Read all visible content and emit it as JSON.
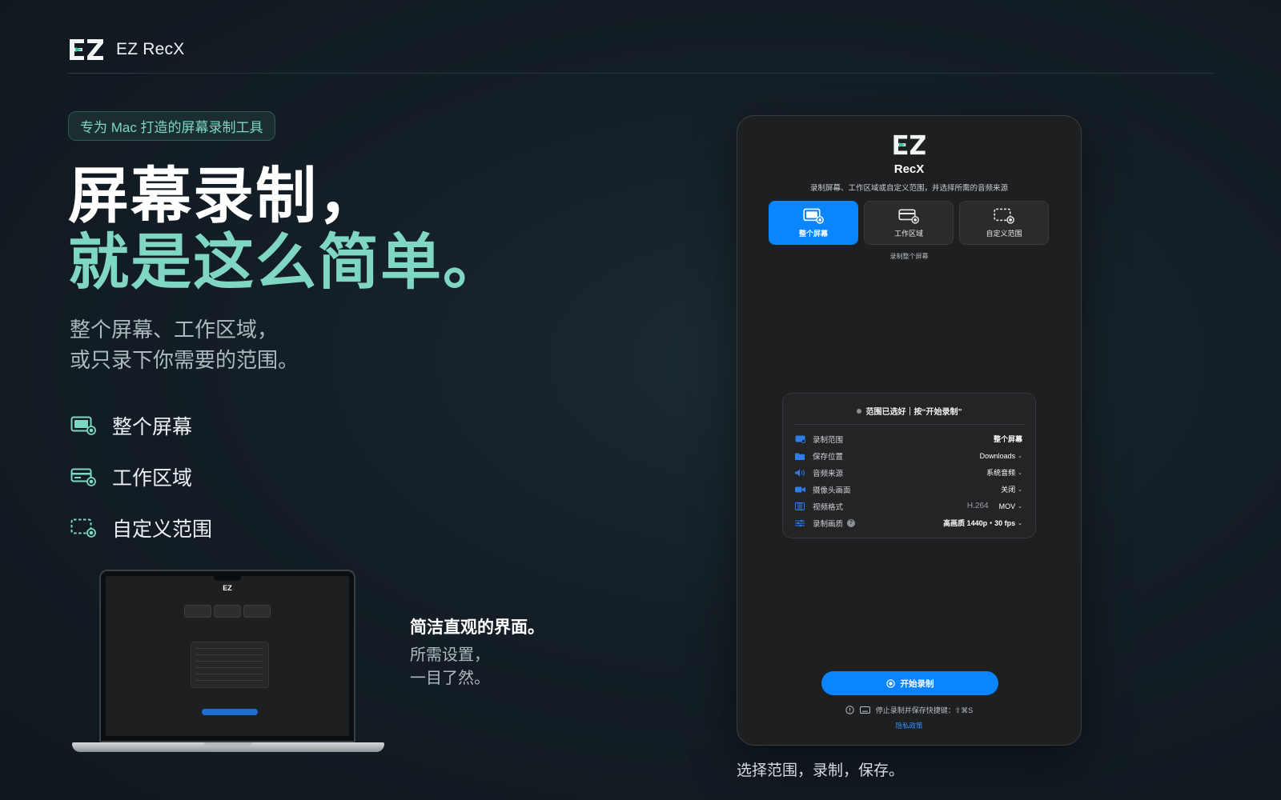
{
  "header": {
    "brand": "EZ RecX"
  },
  "hero": {
    "badge": "专为 Mac 打造的屏幕录制工具",
    "title_line1": "屏幕录制，",
    "title_line2": "就是这么简单。",
    "sub_line1": "整个屏幕、工作区域，",
    "sub_line2": "或只录下你需要的范围。"
  },
  "features": [
    {
      "label": "整个屏幕",
      "icon": "full-screen-icon"
    },
    {
      "label": "工作区域",
      "icon": "work-area-icon"
    },
    {
      "label": "自定义范围",
      "icon": "custom-area-icon"
    }
  ],
  "caption": {
    "title": "简洁直观的界面。",
    "line1": "所需设置，",
    "line2": "一目了然。"
  },
  "app": {
    "title": "RecX",
    "description": "录制屏幕、工作区域或自定义范围，并选择所需的音频来源",
    "modes": [
      {
        "label": "整个屏幕",
        "active": true
      },
      {
        "label": "工作区域",
        "active": false
      },
      {
        "label": "自定义范围",
        "active": false
      }
    ],
    "mode_hint": "录制整个屏幕",
    "status": "范围已选好｜按“开始录制”",
    "settings": [
      {
        "label": "录制范围",
        "value": "整个屏幕",
        "icon": "screen-icon"
      },
      {
        "label": "保存位置",
        "value": "Downloads",
        "icon": "folder-icon"
      },
      {
        "label": "音频来源",
        "value": "系统音频",
        "icon": "speaker-icon"
      },
      {
        "label": "摄像头画面",
        "value": "关闭",
        "icon": "camera-icon"
      },
      {
        "label": "视频格式",
        "codec": "H.264",
        "value": "MOV",
        "icon": "film-icon"
      },
      {
        "label": "录制画质",
        "value": "高画质 1440p・30 fps",
        "icon": "sliders-icon"
      }
    ],
    "start_button": "开始录制",
    "shortcut": "停止录制并保存快捷键：⇧⌘S",
    "privacy": "隐私政策"
  },
  "window_caption": "选择范围，录制，保存。",
  "colors": {
    "accent": "#7fd6c2",
    "primary": "#0a84ff",
    "bg": "#141e26"
  }
}
